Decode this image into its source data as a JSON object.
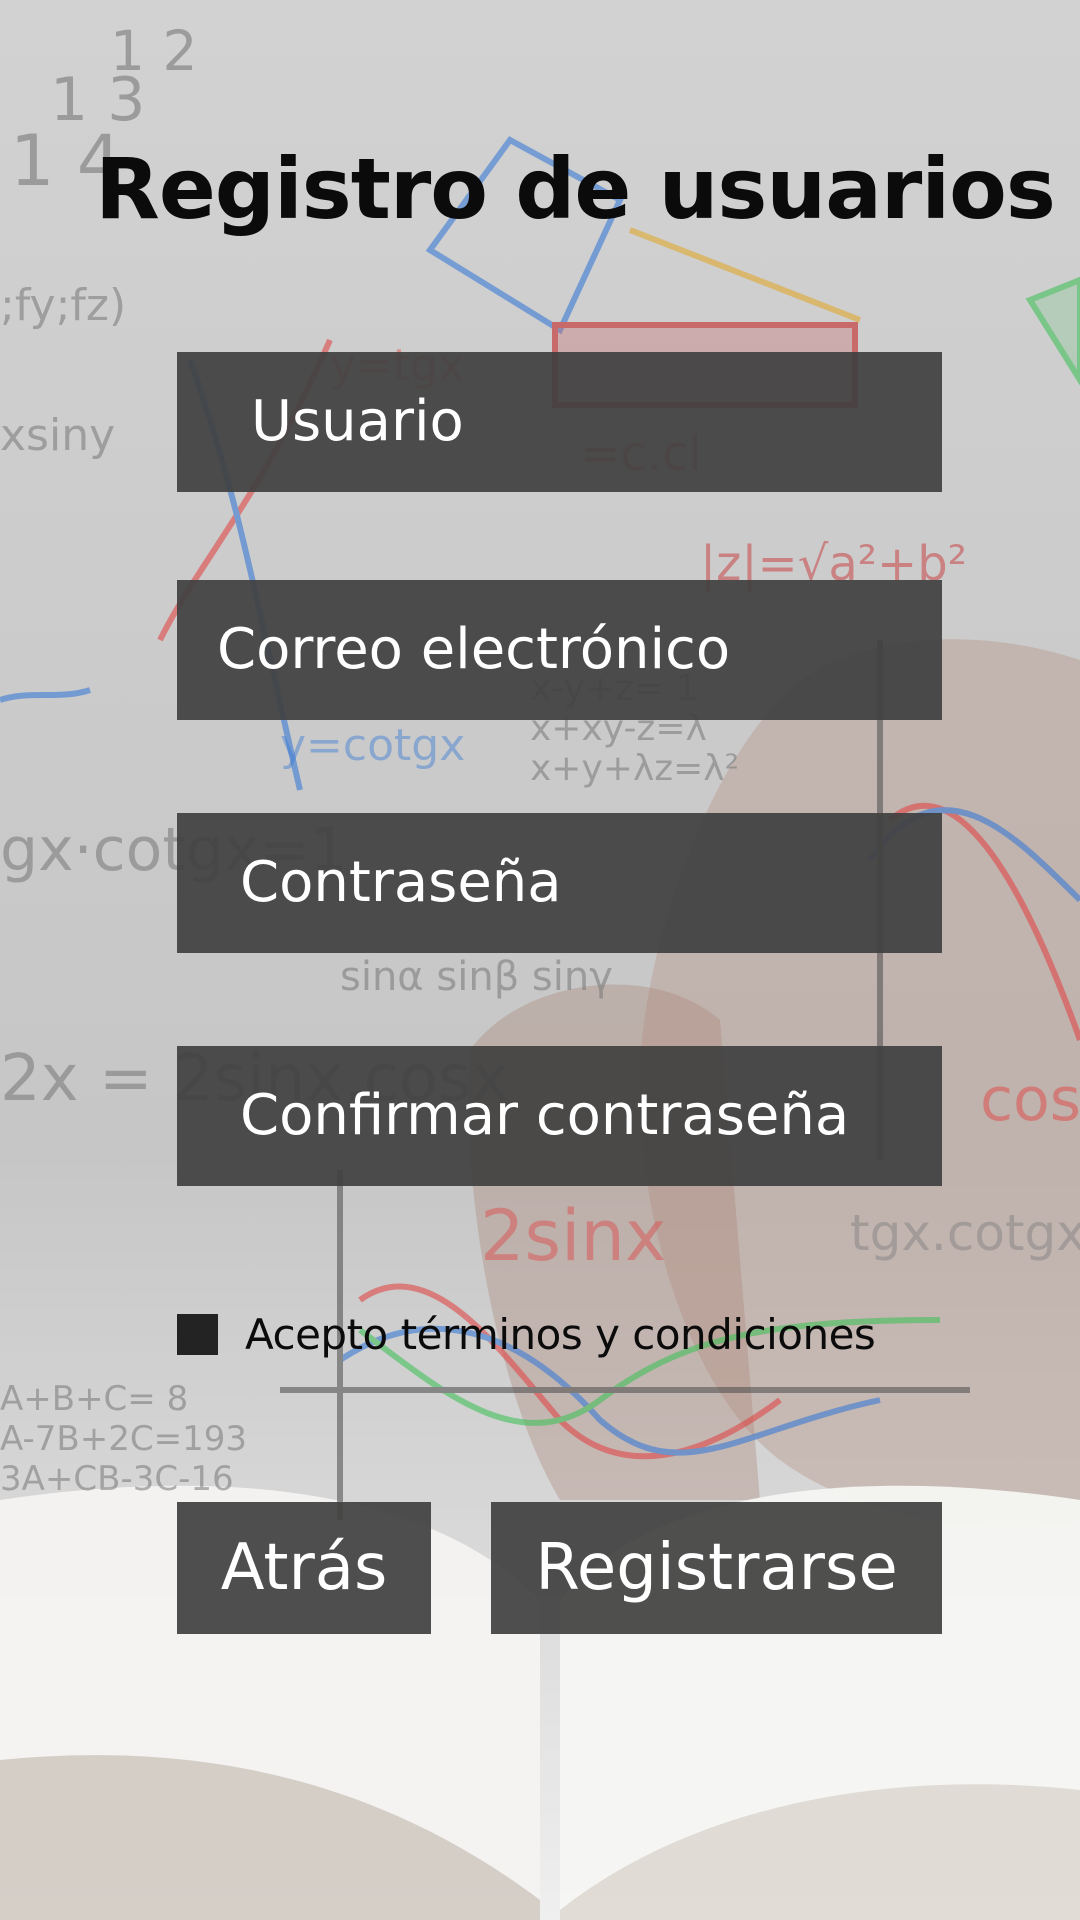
{
  "header": {
    "title": "Registro de usuarios"
  },
  "form": {
    "username": {
      "placeholder": "Usuario"
    },
    "email": {
      "placeholder": "Correo electrónico"
    },
    "password": {
      "placeholder": "Contraseña"
    },
    "confirm_password": {
      "placeholder": "Confirmar contraseña"
    },
    "terms": {
      "label": "Acepto términos y condiciones",
      "checked": false
    }
  },
  "actions": {
    "back_label": "Atrás",
    "register_label": "Registrarse"
  },
  "colors": {
    "field_background": "#404040",
    "field_text": "#ffffff",
    "title_text": "#0b0b0b",
    "checkbox": "#232323"
  }
}
